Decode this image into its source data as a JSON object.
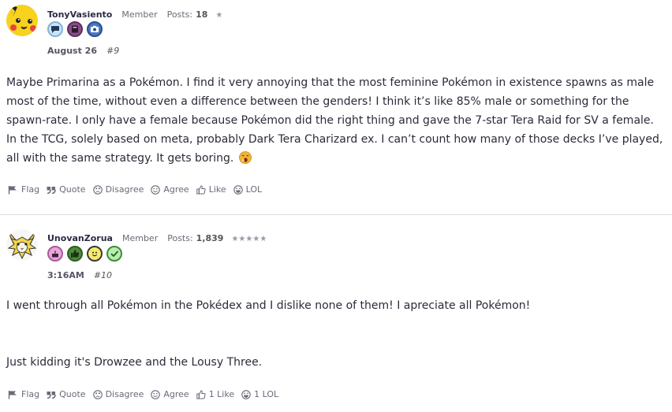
{
  "posts": [
    {
      "username": "TonyVasiento",
      "role": "Member",
      "posts_label": "Posts:",
      "posts_count": "18",
      "stars": "★",
      "date": "August 26",
      "post_number": "#9",
      "body": [
        "Maybe Primarina as a Pokémon. I find it very annoying that the most feminine Pokémon in existence spawns as male most of the time, without even a difference between the genders! I think it’s like 85% male or something for the spawn-rate. I only have a female because Pokémon did the right thing and gave the 7-star Tera Raid for SV a female. In the TCG, solely based on meta, probably Dark Tera Charizard ex. I can’t count how many of those decks I’ve played, all with the same strategy. It gets boring."
      ],
      "actions": {
        "flag": "Flag",
        "quote": "Quote",
        "disagree": "Disagree",
        "agree": "Agree",
        "like": "Like",
        "lol": "LOL"
      },
      "badge_colors": [
        "#7fb4e0",
        "#8b4e8a",
        "#4a79c4"
      ]
    },
    {
      "username": "UnovanZorua",
      "role": "Member",
      "posts_label": "Posts:",
      "posts_count": "1,839",
      "stars": "★★★★★",
      "date": "3:16AM",
      "post_number": "#10",
      "body": [
        "I went through all Pokémon in the Pokédex and I dislike none of them! I apreciate all Pokémon!",
        "",
        "Just kidding it's Drowzee and the Lousy Three."
      ],
      "actions": {
        "flag": "Flag",
        "quote": "Quote",
        "disagree": "Disagree",
        "agree": "Agree",
        "like": "1 Like",
        "lol": "1 LOL"
      },
      "badge_colors": [
        "#d98ac8",
        "#4c8c3c",
        "#f2e24a",
        "#7ed17a"
      ]
    }
  ],
  "icons": {
    "post1_badges": [
      "speech-bubble-icon",
      "book-icon",
      "camera-icon"
    ],
    "post2_badges": [
      "cake-icon",
      "thumbs-up-icon",
      "smiley-icon",
      "checkmark-icon"
    ],
    "actions": [
      "flag-icon",
      "quote-icon",
      "disagree-icon",
      "agree-icon",
      "like-icon",
      "lol-icon"
    ],
    "emoji": "yawning-face-emoji"
  }
}
